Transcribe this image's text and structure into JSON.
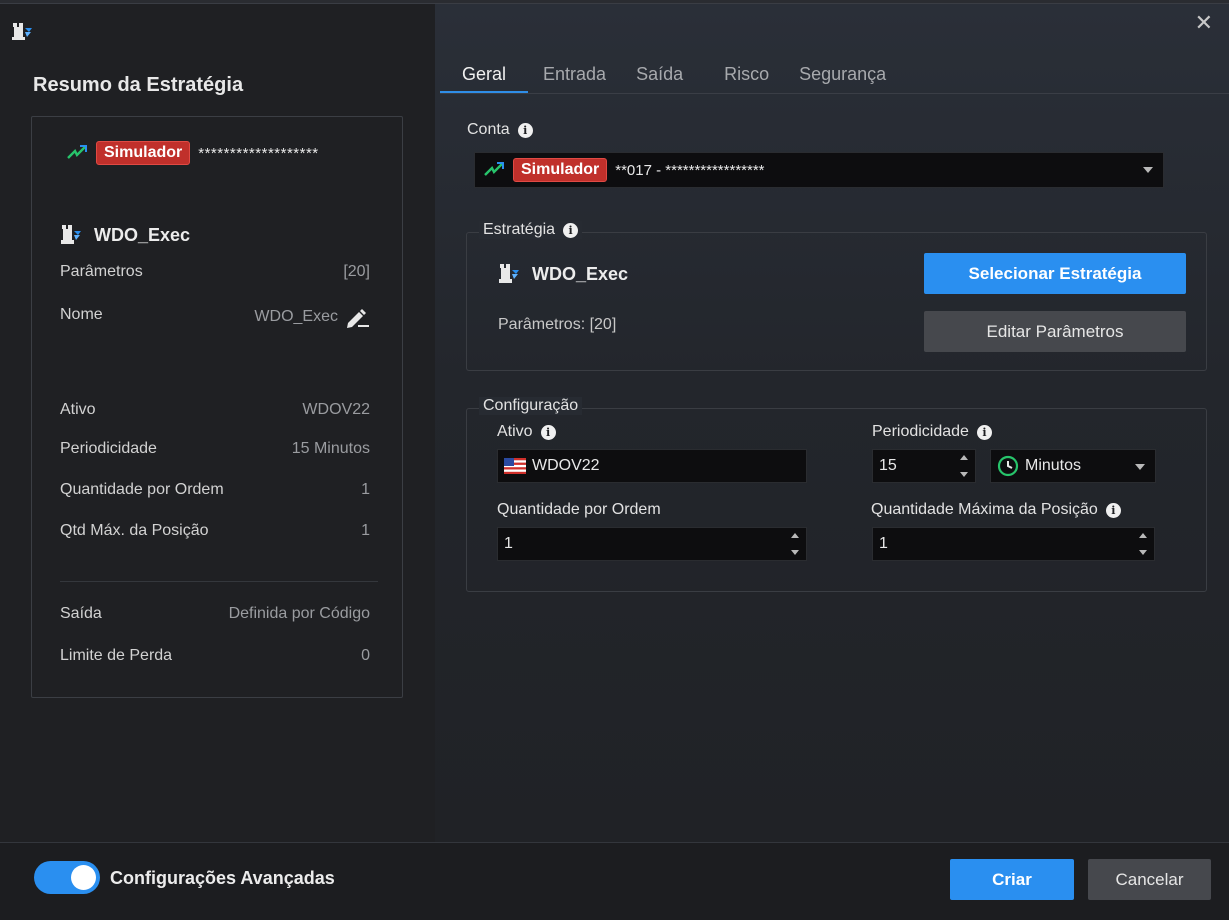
{
  "window": {
    "close_label": "✕"
  },
  "summary": {
    "title": "Resumo da Estratégia",
    "account_badge": "Simulador",
    "account_masked": "*******************",
    "strategy_name": "WDO_Exec",
    "rows_top": [
      {
        "key": "Parâmetros",
        "value": "[20]"
      },
      {
        "key": "Nome",
        "value": "WDO_Exec"
      }
    ],
    "rows_mid": [
      {
        "key": "Ativo",
        "value": "WDOV22"
      },
      {
        "key": "Periodicidade",
        "value": "15 Minutos"
      },
      {
        "key": "Quantidade por Ordem",
        "value": "1"
      },
      {
        "key": "Qtd Máx. da Posição",
        "value": "1"
      }
    ],
    "rows_bottom": [
      {
        "key": "Saída",
        "value": "Definida por Código"
      },
      {
        "key": "Limite de Perda",
        "value": "0"
      }
    ]
  },
  "tabs": [
    "Geral",
    "Entrada",
    "Saída",
    "Risco",
    "Segurança"
  ],
  "active_tab": "Geral",
  "conta": {
    "label": "Conta",
    "badge": "Simulador",
    "account_text": "**017 - *****************"
  },
  "estrategia": {
    "legend": "Estratégia",
    "name": "WDO_Exec",
    "params_label": "Parâmetros: [20]",
    "select_button": "Selecionar Estratégia",
    "edit_button": "Editar Parâmetros"
  },
  "configuracao": {
    "legend": "Configuração",
    "ativo_label": "Ativo",
    "ativo_value": "WDOV22",
    "periodicidade_label": "Periodicidade",
    "periodicidade_value": "15",
    "periodicidade_unit": "Minutos",
    "qtd_ordem_label": "Quantidade por Ordem",
    "qtd_ordem_value": "1",
    "qtd_max_label": "Quantidade Máxima da Posição",
    "qtd_max_value": "1"
  },
  "footer": {
    "advanced_label": "Configurações Avançadas",
    "advanced_on": true,
    "create_button": "Criar",
    "cancel_button": "Cancelar"
  },
  "colors": {
    "accent": "#2a8ff0",
    "simulator_badge": "#c0302b",
    "clock_green": "#27c46b"
  }
}
